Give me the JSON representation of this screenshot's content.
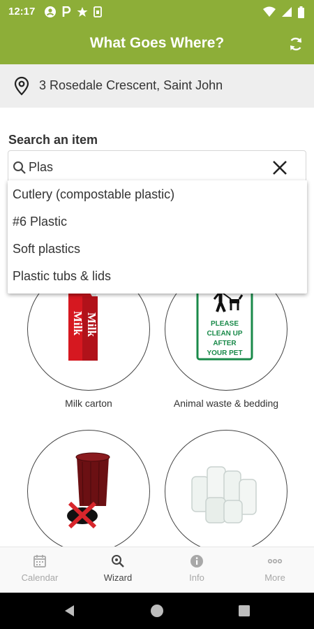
{
  "status_bar": {
    "time": "12:17",
    "left_icons": [
      "account-icon",
      "parking-icon",
      "star-icon",
      "sim-icon"
    ],
    "right_icons": [
      "wifi-icon",
      "signal-icon",
      "battery-icon"
    ]
  },
  "app_bar": {
    "title": "What Goes Where?",
    "refresh_icon": "refresh-icon",
    "background": "#8dae38"
  },
  "address": {
    "icon": "location-pin-icon",
    "text": "3 Rosedale Crescent, Saint John"
  },
  "search": {
    "label": "Search an item",
    "value": "Plas",
    "placeholder": ""
  },
  "suggestions": [
    "Cutlery (compostable plastic)",
    "#6 Plastic",
    "Soft plastics",
    "Plastic tubs & lids"
  ],
  "items": [
    {
      "caption": "Milk carton",
      "image": "milk-carton"
    },
    {
      "caption": "Animal waste & bedding",
      "image": "animal-waste-sign"
    },
    {
      "caption": "",
      "image": "coffee-cup"
    },
    {
      "caption": "",
      "image": "glass-jars"
    }
  ],
  "milk_text": "Milk",
  "sign_text": [
    "PLEASE",
    "CLEAN UP",
    "AFTER",
    "YOUR PET"
  ],
  "bottom_nav": [
    {
      "label": "Calendar",
      "icon": "calendar-icon",
      "active": false
    },
    {
      "label": "Wizard",
      "icon": "wizard-icon",
      "active": true
    },
    {
      "label": "Info",
      "icon": "info-icon",
      "active": false
    },
    {
      "label": "More",
      "icon": "more-icon",
      "active": false
    }
  ]
}
